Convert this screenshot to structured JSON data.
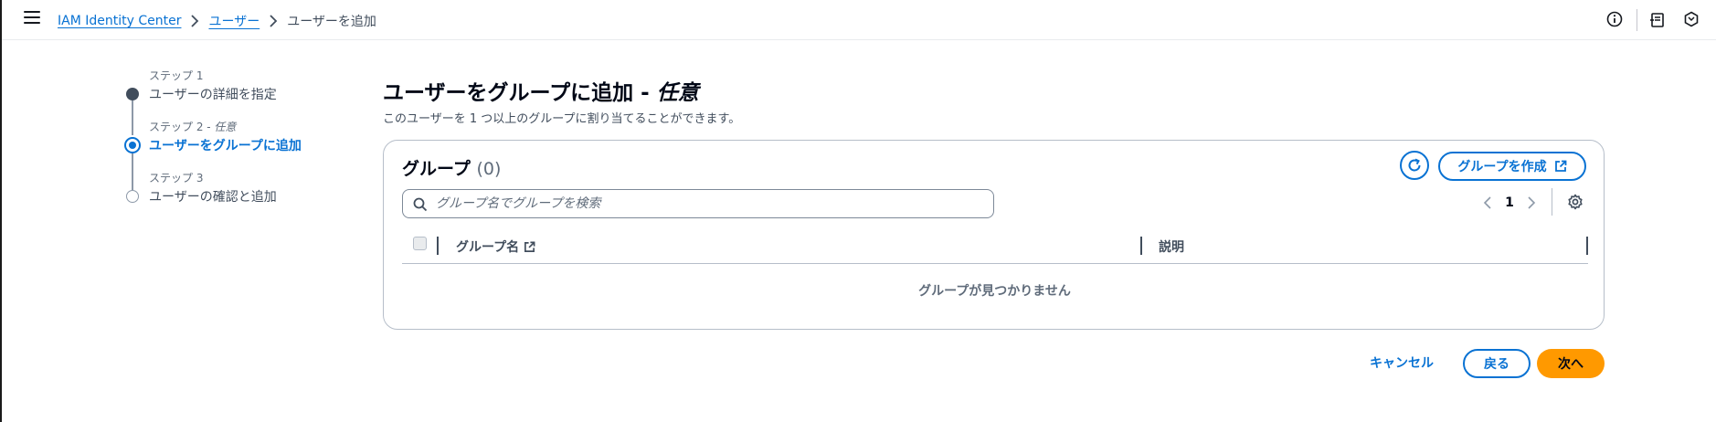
{
  "breadcrumb": {
    "items": [
      "IAM Identity Center",
      "ユーザー"
    ],
    "current": "ユーザーを追加"
  },
  "steps": [
    {
      "small": "ステップ 1",
      "label": "ユーザーの詳細を指定"
    },
    {
      "small": "ステップ 2 - ",
      "small_optional": "任意",
      "label": "ユーザーをグループに追加"
    },
    {
      "small": "ステップ 3",
      "label": "ユーザーの確認と追加"
    }
  ],
  "main": {
    "title": "ユーザーをグループに追加 - ",
    "title_optional": "任意",
    "description": "このユーザーを 1 つ以上のグループに割り当てることができます。"
  },
  "groups": {
    "title": "グループ",
    "count": "(0)",
    "create_label": "グループを作成",
    "search_placeholder": "グループ名でグループを検索",
    "page": "1",
    "columns": [
      "グループ名",
      "説明"
    ],
    "empty": "グループが見つかりません"
  },
  "footer": {
    "cancel": "キャンセル",
    "back": "戻る",
    "next": "次へ"
  },
  "colors": {
    "link": "#0972d3",
    "primary": "#ff9900",
    "text": "#16191f"
  }
}
